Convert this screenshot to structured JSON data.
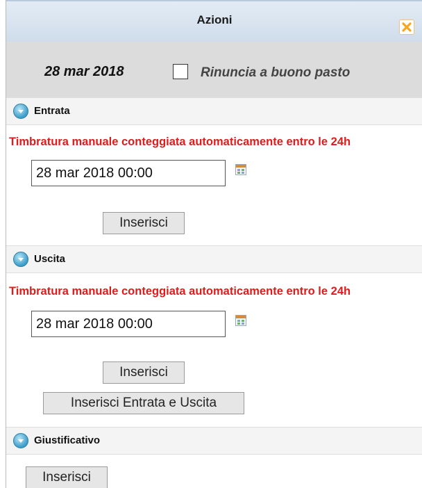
{
  "dialog": {
    "title": "Azioni",
    "close_icon": "close-icon",
    "accent_color": "#f5a623"
  },
  "top": {
    "date": "28 mar 2018",
    "checkbox_label": "Rinuncia a buono pasto",
    "checkbox_checked": false
  },
  "sections": {
    "entrata": {
      "label": "Entrata",
      "icon": "expand-icon",
      "warning": "Timbratura manuale conteggiata automaticamente entro le 24h",
      "datetime_value": "28 mar 2018 00:00",
      "insert_label": "Inserisci"
    },
    "uscita": {
      "label": "Uscita",
      "icon": "expand-icon",
      "warning": "Timbratura manuale conteggiata automaticamente entro le 24h",
      "datetime_value": "28 mar 2018 00:00",
      "insert_label": "Inserisci",
      "insert_both_label": "Inserisci Entrata e Uscita"
    },
    "giustificativo": {
      "label": "Giustificativo",
      "icon": "expand-icon",
      "insert_label": "Inserisci"
    }
  },
  "colors": {
    "warning_text": "#e01b1b",
    "header_bg": "#dcdcdc"
  }
}
